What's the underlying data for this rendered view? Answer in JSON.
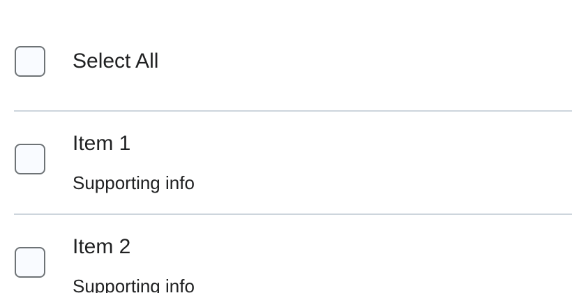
{
  "select_all": {
    "label": "Select All",
    "checked": false
  },
  "items": [
    {
      "label": "Item 1",
      "supporting": "Supporting info",
      "checked": false
    },
    {
      "label": "Item 2",
      "supporting": "Supporting info",
      "checked": false
    }
  ],
  "colors": {
    "checkbox_border": "#6e7376",
    "checkbox_fill": "#f9fbff",
    "divider": "#cdd5dc",
    "text": "#202122"
  }
}
